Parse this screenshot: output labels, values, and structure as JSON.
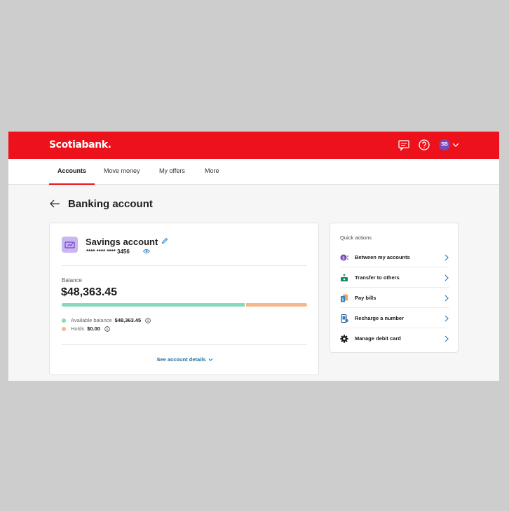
{
  "header": {
    "logo": "Scotiabank.",
    "avatar_initials": "SB",
    "brand_color": "#ec111a"
  },
  "tabs": [
    {
      "label": "Accounts",
      "active": true
    },
    {
      "label": "Move money",
      "active": false
    },
    {
      "label": "My offers",
      "active": false
    },
    {
      "label": "More",
      "active": false
    }
  ],
  "page": {
    "title": "Banking account"
  },
  "account": {
    "name": "Savings account",
    "number": "**** **** **** 3456",
    "balance_label": "Balance",
    "balance": "$48,363.45",
    "available_label": "Available balance",
    "available_value": "$48,363.45",
    "holds_label": "Holds",
    "holds_value": "$0.00",
    "available_fraction": 0.745,
    "available_color": "#87d8bd",
    "holds_color": "#f4b78e",
    "details_link": "See account details"
  },
  "quick_actions": {
    "title": "Quick actions",
    "items": [
      {
        "label": "Between my accounts",
        "icon": "transfer-between-icon"
      },
      {
        "label": "Transfer to others",
        "icon": "send-money-icon"
      },
      {
        "label": "Pay bills",
        "icon": "bill-icon"
      },
      {
        "label": "Recharge a number",
        "icon": "phone-recharge-icon"
      },
      {
        "label": "Manage debit card",
        "icon": "gear-icon"
      }
    ]
  }
}
